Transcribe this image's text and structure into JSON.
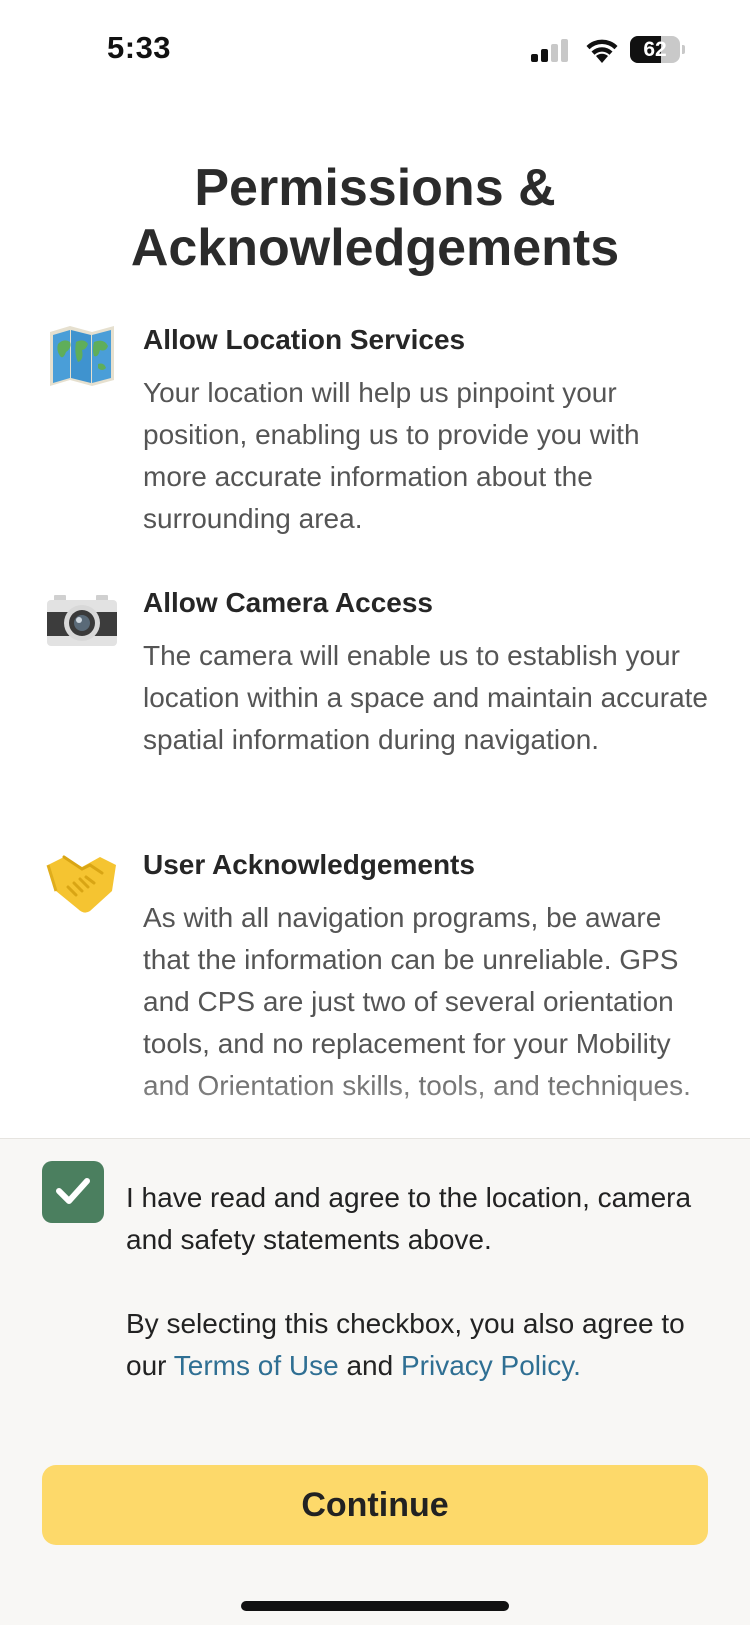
{
  "status_bar": {
    "time": "5:33",
    "battery_level": 62,
    "battery_text": "62",
    "signal_bars_active": 2,
    "signal_bars_total": 4
  },
  "page": {
    "title": "Permissions & Acknowledgements"
  },
  "permissions": [
    {
      "icon": "world-map-icon",
      "heading": "Allow Location Services",
      "body": "Your location will help us pinpoint your position, enabling us to provide you with more accurate information about the surrounding area."
    },
    {
      "icon": "camera-icon",
      "heading": "Allow Camera Access",
      "body": "The camera will enable us to establish your location within a space and maintain accurate spatial information during navigation."
    },
    {
      "icon": "handshake-icon",
      "heading": "User Acknowledgements",
      "body": "As with all navigation programs, be aware that the information can be unreliable. GPS and CPS are just two of several orientation tools, and no replacement for your Mobility and Orientation skills, tools, and techniques."
    }
  ],
  "agreement": {
    "checked": true,
    "statement": "I have read and agree to the location, camera and safety statements above.",
    "consent_prefix": "By selecting this checkbox, you also agree to our",
    "terms_link": "Terms of Use",
    "consent_and": "and",
    "privacy_link": "Privacy Policy."
  },
  "actions": {
    "continue_label": "Continue"
  },
  "colors": {
    "checkbox_green": "#4b7f5f",
    "link_blue": "#2f6f93",
    "continue_yellow": "#fdd96a",
    "panel_bg": "#f8f7f5"
  }
}
